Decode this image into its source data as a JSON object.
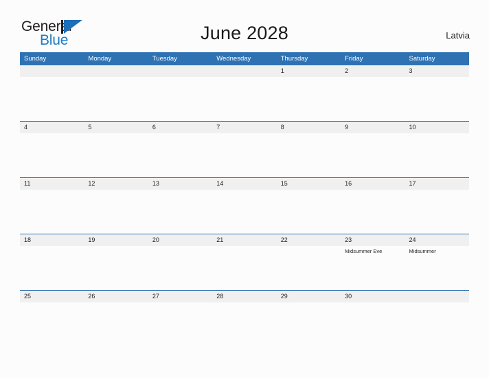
{
  "logo": {
    "word1": "General",
    "word2": "Blue",
    "mark": "triangle-logo-mark",
    "colors": {
      "word1": "#231f20",
      "word2": "#1d7cc4",
      "triangle": "#1d6fb8"
    }
  },
  "header": {
    "title": "June 2028",
    "country": "Latvia"
  },
  "calendar": {
    "accent_color": "#2e72b4",
    "date_band_color": "#f0f0f0",
    "weekdays": [
      "Sunday",
      "Monday",
      "Tuesday",
      "Wednesday",
      "Thursday",
      "Friday",
      "Saturday"
    ],
    "weeks": [
      {
        "days": [
          {
            "date": "",
            "events": []
          },
          {
            "date": "",
            "events": []
          },
          {
            "date": "",
            "events": []
          },
          {
            "date": "",
            "events": []
          },
          {
            "date": "1",
            "events": []
          },
          {
            "date": "2",
            "events": []
          },
          {
            "date": "3",
            "events": []
          }
        ]
      },
      {
        "days": [
          {
            "date": "4",
            "events": []
          },
          {
            "date": "5",
            "events": []
          },
          {
            "date": "6",
            "events": []
          },
          {
            "date": "7",
            "events": []
          },
          {
            "date": "8",
            "events": []
          },
          {
            "date": "9",
            "events": []
          },
          {
            "date": "10",
            "events": []
          }
        ]
      },
      {
        "days": [
          {
            "date": "11",
            "events": []
          },
          {
            "date": "12",
            "events": []
          },
          {
            "date": "13",
            "events": []
          },
          {
            "date": "14",
            "events": []
          },
          {
            "date": "15",
            "events": []
          },
          {
            "date": "16",
            "events": []
          },
          {
            "date": "17",
            "events": []
          }
        ]
      },
      {
        "days": [
          {
            "date": "18",
            "events": []
          },
          {
            "date": "19",
            "events": []
          },
          {
            "date": "20",
            "events": []
          },
          {
            "date": "21",
            "events": []
          },
          {
            "date": "22",
            "events": []
          },
          {
            "date": "23",
            "events": [
              "Midsummer Eve"
            ]
          },
          {
            "date": "24",
            "events": [
              "Midsummer"
            ]
          }
        ]
      },
      {
        "days": [
          {
            "date": "25",
            "events": []
          },
          {
            "date": "26",
            "events": []
          },
          {
            "date": "27",
            "events": []
          },
          {
            "date": "28",
            "events": []
          },
          {
            "date": "29",
            "events": []
          },
          {
            "date": "30",
            "events": []
          },
          {
            "date": "",
            "events": []
          }
        ]
      }
    ]
  }
}
